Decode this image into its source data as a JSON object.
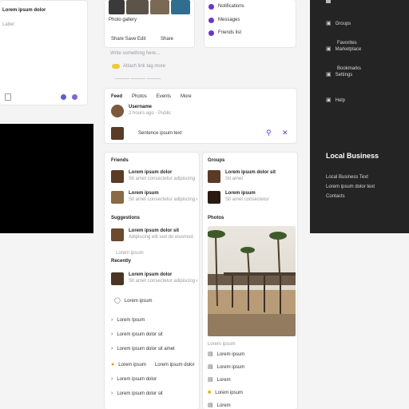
{
  "left_panel": {
    "title": "Lorem ipsum dolor",
    "label": "Label",
    "footer_icons": [
      "calendar-icon",
      "circle-icon",
      "edit-icon"
    ]
  },
  "top_center": {
    "caption": "Photo gallery",
    "action": "Share  Save  Edit",
    "action2": "Share",
    "composer_placeholder": "Write something here...",
    "composer_link": "Attach  link   tag  more",
    "feed_tabs": [
      "Feed",
      "Photos",
      "Events",
      "More"
    ],
    "post_author": "Username",
    "post_time": "2 hours ago · Public",
    "post_text": "Sentence ipsum text"
  },
  "top_right_list": [
    {
      "label": "Notifications",
      "color": "#6a35c9"
    },
    {
      "label": "Messages",
      "color": "#6a35c9"
    },
    {
      "label": "Friends list",
      "color": "#6a35c9"
    }
  ],
  "right_dark": {
    "items": [
      "Groups",
      "Favorites",
      "Marketplace",
      "Bookmarks",
      "Settings",
      "Help"
    ],
    "heading": "Local Business",
    "desc_1": "Local Business Text",
    "desc_2": "Lorem ipsum dolor text",
    "desc_3": "Contacts"
  },
  "lower_left": {
    "section_1": "Friends",
    "friends": [
      {
        "name": "Lorem ipsum dolor",
        "sub": "Sit amet consectetur adipiscing"
      },
      {
        "name": "Lorem ipsum",
        "sub": "Sit amet consectetur adipiscing elit"
      }
    ],
    "section_2": "Suggestions",
    "suggestion": {
      "name": "Lorem ipsum dolor sit",
      "sub": "Adipiscing elit sed do eiusmod"
    },
    "section_3": "Lorem ipsum",
    "section_4": "Recently",
    "recent": {
      "name": "Lorem ipsum dolor",
      "sub": "Sit amet consectetur adipiscing elit"
    },
    "items": [
      {
        "icon": "clock-icon",
        "label": "Lorem ipsum"
      },
      {
        "icon": "chevron-icon",
        "label": "Lorem Ipsum"
      },
      {
        "icon": "chevron-icon",
        "label": "Lorem ipsum dolor sit"
      },
      {
        "icon": "chevron-icon",
        "label": "Lorem ipsum dolor sit amet"
      }
    ],
    "bottom_rows": [
      {
        "icon": "sun-icon",
        "label": "Lorem ipsum",
        "extra": "Lorem ipsum dolor"
      },
      {
        "icon": "chevron-icon",
        "label": "Lorem ipsum dolor"
      },
      {
        "icon": "chevron-icon",
        "label": "Lorem ipsum dolor sit"
      }
    ]
  },
  "lower_right": {
    "section_1": "Groups",
    "groups": [
      {
        "name": "Lorem ipsum dolor sit",
        "sub": "Sit amet"
      },
      {
        "name": "Lorem ipsum",
        "sub": "Sit amet consectetur"
      }
    ],
    "section_2": "Photos",
    "caption": "Lorem ipsum",
    "list": [
      {
        "icon": "doc-icon",
        "label": "Lorem ipsum"
      },
      {
        "icon": "doc-icon",
        "label": "Lorem ipsum"
      },
      {
        "icon": "doc-icon",
        "label": "Lorem"
      },
      {
        "icon": "star-icon",
        "label": "Lorem ipsum"
      },
      {
        "icon": "doc-icon",
        "label": "Lorem"
      }
    ]
  }
}
